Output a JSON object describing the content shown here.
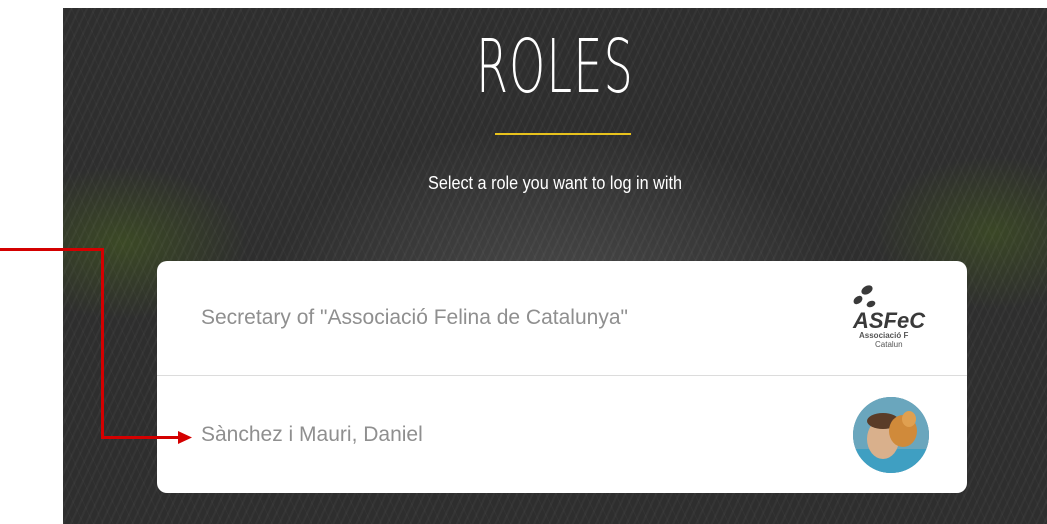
{
  "header": {
    "title": "ROLES",
    "subtitle": "Select a role you want to log in with"
  },
  "roles": [
    {
      "label": "Secretary of \"Associació Felina de Catalunya\"",
      "icon": "asfec-logo"
    },
    {
      "label": "Sànchez i Mauri, Daniel",
      "icon": "user-avatar"
    }
  ],
  "logo": {
    "text_main": "ASFeC",
    "text_line1": "Associació F",
    "text_line2": "Catalun"
  },
  "colors": {
    "accent": "#e8c21c",
    "annotation": "#d40000",
    "label": "#8f8f8f"
  }
}
